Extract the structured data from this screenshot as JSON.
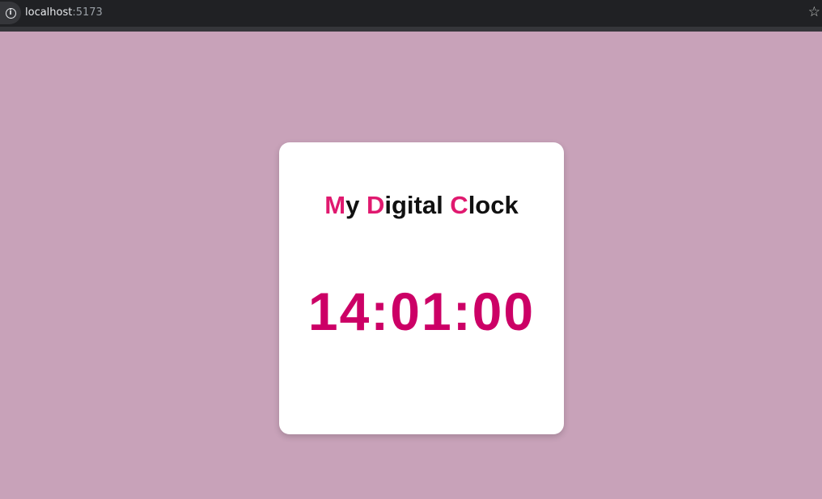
{
  "browser": {
    "url_host": "localhost",
    "url_port": ":5173",
    "info_icon_glyph": "i",
    "star_icon_glyph": "☆"
  },
  "clock": {
    "title_parts": [
      {
        "text": "M",
        "accent": true
      },
      {
        "text": "y ",
        "accent": false
      },
      {
        "text": "D",
        "accent": true
      },
      {
        "text": "igital ",
        "accent": false
      },
      {
        "text": "C",
        "accent": true
      },
      {
        "text": "lock",
        "accent": false
      }
    ],
    "time": "14:01:00"
  },
  "colors": {
    "page_background": "#c8a2b9",
    "card_background": "#ffffff",
    "title_accent": "#e0196f",
    "time_color": "#cc0066"
  }
}
